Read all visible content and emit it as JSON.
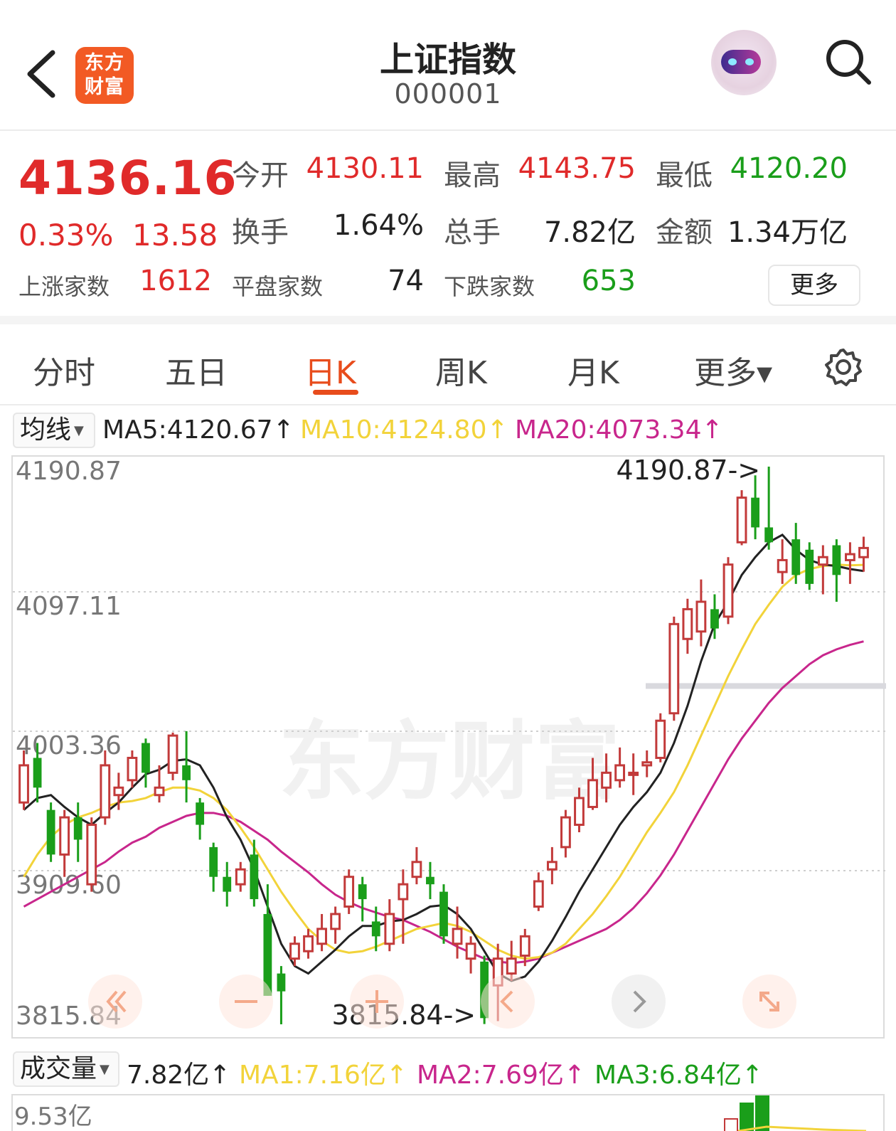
{
  "header": {
    "title": "上证指数",
    "code": "000001",
    "logo_line1": "东方",
    "logo_line2": "财富"
  },
  "quote": {
    "price": "4136.16",
    "change_pct": "0.33%",
    "change_abs": "13.58",
    "open_label": "今开",
    "open_value": "4130.11",
    "high_label": "最高",
    "high_value": "4143.75",
    "low_label": "最低",
    "low_value": "4120.20",
    "turnover_label": "换手",
    "turnover_value": "1.64%",
    "volume_label": "总手",
    "volume_value": "7.82亿",
    "amount_label": "金额",
    "amount_value": "1.34万亿",
    "up_label": "上涨家数",
    "up_value": "1612",
    "flat_label": "平盘家数",
    "flat_value": "74",
    "down_label": "下跌家数",
    "down_value": "653",
    "more_label": "更多"
  },
  "tabs": [
    {
      "label": "分时"
    },
    {
      "label": "五日"
    },
    {
      "label": "日K"
    },
    {
      "label": "周K"
    },
    {
      "label": "月K"
    },
    {
      "label": "更多▾"
    }
  ],
  "ma_legend": {
    "selector": "均线",
    "ma5": "MA5:4120.67↑",
    "ma10": "MA10:4124.80↑",
    "ma20": "MA20:4073.34↑"
  },
  "volume_legend": {
    "selector": "成交量",
    "value": "7.82亿↑",
    "ma1": "MA1:7.16亿↑",
    "ma2": "MA2:7.69亿↑",
    "ma3": "MA3:6.84亿↑",
    "axis_max": "9.53亿"
  },
  "watermark": "东方财富",
  "colors": {
    "up": "#e02a2a",
    "down": "#1a9e1a",
    "ma5": "#222222",
    "ma10": "#f2d33a",
    "ma20": "#c8268c",
    "accent": "#e84c1c"
  },
  "chart_data": {
    "type": "candlestick",
    "y_ticks": [
      "4190.87",
      "4097.11",
      "4003.36",
      "3909.60",
      "3815.84"
    ],
    "ylim": [
      3815.84,
      4190.87
    ],
    "high_annotation": "4190.87->",
    "low_annotation": "3815.84->",
    "grid": true,
    "candles": [
      {
        "o": 3965,
        "c": 3990,
        "h": 4000,
        "l": 3960
      },
      {
        "o": 3995,
        "c": 3975,
        "h": 4005,
        "l": 3965
      },
      {
        "o": 3960,
        "c": 3930,
        "h": 3965,
        "l": 3925
      },
      {
        "o": 3930,
        "c": 3955,
        "h": 3960,
        "l": 3915
      },
      {
        "o": 3955,
        "c": 3940,
        "h": 3965,
        "l": 3925
      },
      {
        "o": 3910,
        "c": 3950,
        "h": 3955,
        "l": 3905
      },
      {
        "o": 3955,
        "c": 3990,
        "h": 4000,
        "l": 3950
      },
      {
        "o": 3970,
        "c": 3975,
        "h": 3985,
        "l": 3960
      },
      {
        "o": 3980,
        "c": 3995,
        "h": 4000,
        "l": 3975
      },
      {
        "o": 4005,
        "c": 3985,
        "h": 4008,
        "l": 3975
      },
      {
        "o": 3970,
        "c": 3975,
        "h": 3990,
        "l": 3965
      },
      {
        "o": 3985,
        "c": 4010,
        "h": 4012,
        "l": 3980
      },
      {
        "o": 3990,
        "c": 3980,
        "h": 4013,
        "l": 3965
      },
      {
        "o": 3965,
        "c": 3950,
        "h": 3968,
        "l": 3940
      },
      {
        "o": 3935,
        "c": 3915,
        "h": 3938,
        "l": 3905
      },
      {
        "o": 3915,
        "c": 3905,
        "h": 3925,
        "l": 3895
      },
      {
        "o": 3910,
        "c": 3920,
        "h": 3925,
        "l": 3905
      },
      {
        "o": 3930,
        "c": 3900,
        "h": 3940,
        "l": 3895
      },
      {
        "o": 3890,
        "c": 3835,
        "h": 3910,
        "l": 3835
      },
      {
        "o": 3850,
        "c": 3838,
        "h": 3855,
        "l": 3815.84
      },
      {
        "o": 3860,
        "c": 3870,
        "h": 3875,
        "l": 3855
      },
      {
        "o": 3865,
        "c": 3875,
        "h": 3880,
        "l": 3860
      },
      {
        "o": 3870,
        "c": 3880,
        "h": 3890,
        "l": 3865
      },
      {
        "o": 3880,
        "c": 3890,
        "h": 3895,
        "l": 3870
      },
      {
        "o": 3895,
        "c": 3915,
        "h": 3920,
        "l": 3890
      },
      {
        "o": 3910,
        "c": 3900,
        "h": 3915,
        "l": 3885
      },
      {
        "o": 3885,
        "c": 3875,
        "h": 3895,
        "l": 3865
      },
      {
        "o": 3870,
        "c": 3890,
        "h": 3900,
        "l": 3865
      },
      {
        "o": 3900,
        "c": 3910,
        "h": 3920,
        "l": 3870
      },
      {
        "o": 3915,
        "c": 3925,
        "h": 3935,
        "l": 3910
      },
      {
        "o": 3915,
        "c": 3910,
        "h": 3925,
        "l": 3900
      },
      {
        "o": 3905,
        "c": 3875,
        "h": 3910,
        "l": 3870
      },
      {
        "o": 3870,
        "c": 3880,
        "h": 3895,
        "l": 3860
      },
      {
        "o": 3860,
        "c": 3870,
        "h": 3875,
        "l": 3850
      },
      {
        "o": 3858,
        "c": 3820,
        "h": 3862,
        "l": 3816
      },
      {
        "o": 3842,
        "c": 3860,
        "h": 3870,
        "l": 3818
      },
      {
        "o": 3850,
        "c": 3860,
        "h": 3872,
        "l": 3845
      },
      {
        "o": 3862,
        "c": 3875,
        "h": 3880,
        "l": 3855
      },
      {
        "o": 3895,
        "c": 3912,
        "h": 3918,
        "l": 3892
      },
      {
        "o": 3920,
        "c": 3925,
        "h": 3935,
        "l": 3910
      },
      {
        "o": 3935,
        "c": 3955,
        "h": 3960,
        "l": 3928
      },
      {
        "o": 3950,
        "c": 3968,
        "h": 3975,
        "l": 3945
      },
      {
        "o": 3962,
        "c": 3980,
        "h": 3995,
        "l": 3960
      },
      {
        "o": 3975,
        "c": 3985,
        "h": 3998,
        "l": 3965
      },
      {
        "o": 3980,
        "c": 3990,
        "h": 4002,
        "l": 3975
      },
      {
        "o": 3985,
        "c": 3985,
        "h": 3998,
        "l": 3970
      },
      {
        "o": 3990,
        "c": 3992,
        "h": 4000,
        "l": 3982
      },
      {
        "o": 3995,
        "c": 4020,
        "h": 4025,
        "l": 3992
      },
      {
        "o": 4025,
        "c": 4085,
        "h": 4090,
        "l": 4020
      },
      {
        "o": 4075,
        "c": 4095,
        "h": 4102,
        "l": 4065
      },
      {
        "o": 4080,
        "c": 4100,
        "h": 4115,
        "l": 4070
      },
      {
        "o": 4095,
        "c": 4082,
        "h": 4105,
        "l": 4075
      },
      {
        "o": 4090,
        "c": 4125,
        "h": 4130,
        "l": 4085
      },
      {
        "o": 4140,
        "c": 4170,
        "h": 4175,
        "l": 4138
      },
      {
        "o": 4170,
        "c": 4150,
        "h": 4185,
        "l": 4142
      },
      {
        "o": 4150,
        "c": 4140,
        "h": 4190.87,
        "l": 4135
      },
      {
        "o": 4120,
        "c": 4128,
        "h": 4142,
        "l": 4112
      },
      {
        "o": 4142,
        "c": 4118,
        "h": 4153,
        "l": 4112
      },
      {
        "o": 4135,
        "c": 4112,
        "h": 4140,
        "l": 4108
      },
      {
        "o": 4125,
        "c": 4130,
        "h": 4138,
        "l": 4105
      },
      {
        "o": 4138,
        "c": 4118,
        "h": 4142,
        "l": 4100
      },
      {
        "o": 4128,
        "c": 4132,
        "h": 4140,
        "l": 4112
      },
      {
        "o": 4130,
        "c": 4136.16,
        "h": 4143.75,
        "l": 4120.2
      }
    ],
    "ma5": [
      3960,
      3968,
      3970,
      3962,
      3955,
      3950,
      3958,
      3965,
      3975,
      3984,
      3987,
      3993,
      3994,
      3990,
      3975,
      3955,
      3940,
      3920,
      3895,
      3870,
      3855,
      3850,
      3858,
      3866,
      3875,
      3882,
      3882,
      3885,
      3886,
      3890,
      3895,
      3896,
      3890,
      3880,
      3865,
      3850,
      3845,
      3848,
      3858,
      3872,
      3888,
      3905,
      3920,
      3935,
      3950,
      3962,
      3972,
      3985,
      4005,
      4030,
      4060,
      4085,
      4100,
      4118,
      4130,
      4140,
      4145,
      4135,
      4128,
      4125,
      4124,
      4122,
      4120.67
    ],
    "ma10": [
      3915,
      3930,
      3942,
      3950,
      3955,
      3958,
      3962,
      3965,
      3966,
      3968,
      3972,
      3975,
      3975,
      3973,
      3968,
      3960,
      3948,
      3935,
      3920,
      3905,
      3892,
      3880,
      3872,
      3866,
      3864,
      3865,
      3868,
      3872,
      3876,
      3880,
      3882,
      3884,
      3882,
      3878,
      3872,
      3866,
      3862,
      3860,
      3861,
      3864,
      3870,
      3880,
      3890,
      3902,
      3915,
      3930,
      3945,
      3958,
      3972,
      3990,
      4010,
      4030,
      4050,
      4068,
      4085,
      4098,
      4110,
      4118,
      4122,
      4124,
      4125,
      4124.5,
      4124.8
    ],
    "ma20": [
      3895,
      3900,
      3905,
      3910,
      3915,
      3920,
      3925,
      3932,
      3938,
      3942,
      3948,
      3952,
      3956,
      3958,
      3958,
      3956,
      3952,
      3946,
      3940,
      3932,
      3925,
      3918,
      3910,
      3903,
      3898,
      3894,
      3891,
      3888,
      3886,
      3882,
      3878,
      3873,
      3868,
      3864,
      3860,
      3858,
      3857,
      3858,
      3860,
      3864,
      3868,
      3872,
      3876,
      3880,
      3886,
      3894,
      3904,
      3916,
      3930,
      3946,
      3962,
      3978,
      3994,
      4008,
      4020,
      4032,
      4042,
      4050,
      4058,
      4064,
      4068,
      4071,
      4073.34
    ]
  }
}
